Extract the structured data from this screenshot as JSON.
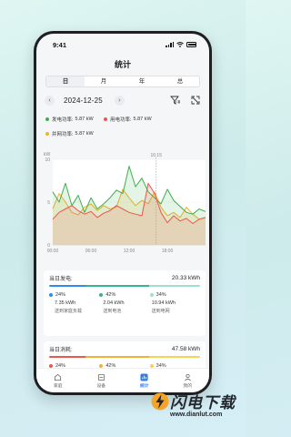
{
  "status_bar": {
    "time": "9:41"
  },
  "header": {
    "title": "统计"
  },
  "tabs": [
    {
      "label": "日",
      "active": true
    },
    {
      "label": "月",
      "active": false
    },
    {
      "label": "年",
      "active": false
    },
    {
      "label": "总",
      "active": false
    }
  ],
  "date_nav": {
    "date": "2024-12-25",
    "prev_icon": "chevron-left-icon",
    "next_icon": "chevron-right-icon"
  },
  "legend": [
    {
      "label": "发电功率:",
      "value": "5.87 kW",
      "color": "#3fae4f"
    },
    {
      "label": "用电功率:",
      "value": "5.87 kW",
      "color": "#e8584f"
    },
    {
      "label": "并网功率:",
      "value": "5.87 kW",
      "color": "#f2b233"
    }
  ],
  "chart_data": {
    "type": "area",
    "ylabel": "kW",
    "ylim": [
      0,
      10
    ],
    "yticks": [
      "10",
      "5",
      "0"
    ],
    "xticks": [
      "00:00",
      "06:00",
      "12:00",
      "18:00"
    ],
    "cursor_label": "16:15",
    "x_hours": [
      0,
      1,
      2,
      3,
      4,
      5,
      6,
      7,
      8,
      9,
      10,
      11,
      12,
      13,
      14,
      15,
      16,
      17,
      18,
      19,
      20,
      21,
      22,
      23,
      24
    ],
    "series": [
      {
        "name": "发电功率",
        "color": "#3fae4f",
        "values": [
          6.2,
          5.0,
          7.2,
          4.6,
          5.8,
          3.8,
          5.5,
          4.2,
          4.8,
          5.5,
          6.4,
          6.0,
          9.2,
          6.8,
          7.8,
          6.2,
          5.5,
          4.8,
          6.5,
          5.2,
          4.5,
          3.8,
          3.6,
          4.2,
          3.9
        ]
      },
      {
        "name": "用电功率",
        "color": "#e8584f",
        "values": [
          3.0,
          3.8,
          4.2,
          4.6,
          4.0,
          3.6,
          3.9,
          3.2,
          3.7,
          4.0,
          4.6,
          4.2,
          3.8,
          3.6,
          3.4,
          7.2,
          6.0,
          3.8,
          2.6,
          3.4,
          2.8,
          3.1,
          2.5,
          3.0,
          3.2
        ]
      },
      {
        "name": "并网功率",
        "color": "#f2b233",
        "values": [
          4.2,
          6.0,
          5.0,
          3.8,
          3.5,
          4.4,
          4.8,
          4.0,
          4.6,
          4.2,
          4.4,
          6.5,
          5.5,
          4.6,
          5.2,
          4.8,
          6.2,
          4.4,
          3.4,
          3.8,
          3.2,
          4.4,
          3.6,
          3.0,
          3.2
        ]
      }
    ]
  },
  "generation_card": {
    "title": "当日发电:",
    "total": "20.33 kWh",
    "items": [
      {
        "percent": "24%",
        "kwh": "7.35 kWh",
        "desc": "送到家庭负载",
        "color": "#2f8bf4"
      },
      {
        "percent": "42%",
        "kwh": "2.04 kWh",
        "desc": "送到电池",
        "color": "#37b48f"
      },
      {
        "percent": "34%",
        "kwh": "10.94 kWh",
        "desc": "送到电网",
        "color": "#9fdfd0"
      }
    ],
    "bar_fractions": [
      0.24,
      0.42,
      0.34
    ]
  },
  "consumption_card": {
    "title": "当日消耗:",
    "total": "47.58 kWh",
    "items": [
      {
        "percent": "24%",
        "color": "#e8584f"
      },
      {
        "percent": "42%",
        "color": "#f2b233"
      },
      {
        "percent": "34%",
        "color": "#f5d25a"
      }
    ],
    "bar_fractions": [
      0.24,
      0.42,
      0.34
    ]
  },
  "bottom_nav": [
    {
      "label": "家庭",
      "icon": "home-icon",
      "active": false
    },
    {
      "label": "设备",
      "icon": "device-icon",
      "active": false
    },
    {
      "label": "统计",
      "icon": "stats-icon",
      "active": true
    },
    {
      "label": "我的",
      "icon": "user-icon",
      "active": false
    }
  ],
  "watermark": {
    "text": "闪电下载",
    "url": "www.dianlut.com"
  }
}
